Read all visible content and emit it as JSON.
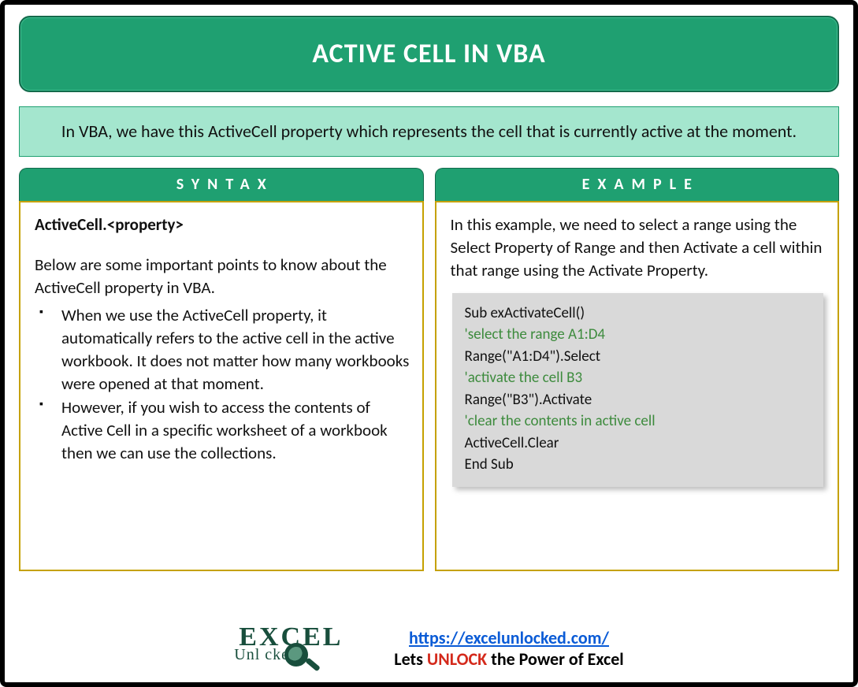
{
  "title": "ACTIVE CELL IN VBA",
  "intro": "In VBA, we have this ActiveCell property which represents the cell that is currently active at the moment.",
  "syntax": {
    "tab": "SYNTAX",
    "signature": "ActiveCell.<property>",
    "lead": "Below are some important points to know about the ActiveCell property in VBA.",
    "bullets": [
      "When we use the ActiveCell property, it automatically refers to the active cell in the active workbook. It does not matter how many workbooks were opened at that moment.",
      "However, if you wish to access the contents of Active Cell in a specific worksheet of a workbook then we can use the collections."
    ]
  },
  "example": {
    "tab": "EXAMPLE",
    "lead": "In this example, we need to select a range using the Select Property of Range and then Activate a cell within that range using the Activate Property.",
    "code": [
      {
        "type": "code",
        "text": "Sub exActivateCell()"
      },
      {
        "type": "comment",
        "text": "'select the range A1:D4"
      },
      {
        "type": "code",
        "text": "Range(\"A1:D4\").Select"
      },
      {
        "type": "comment",
        "text": "'activate the cell B3"
      },
      {
        "type": "code",
        "text": "Range(\"B3\").Activate"
      },
      {
        "type": "comment",
        "text": "'clear the contents in active cell"
      },
      {
        "type": "code",
        "text": "ActiveCell.Clear"
      },
      {
        "type": "code",
        "text": "End Sub"
      }
    ]
  },
  "footer": {
    "logo_top": "EXCEL",
    "logo_bottom": "Unl   cked",
    "url": "https://excelunlocked.com/",
    "tagline_pre": "Lets ",
    "tagline_highlight": "UNLOCK",
    "tagline_post": " the Power of Excel"
  }
}
